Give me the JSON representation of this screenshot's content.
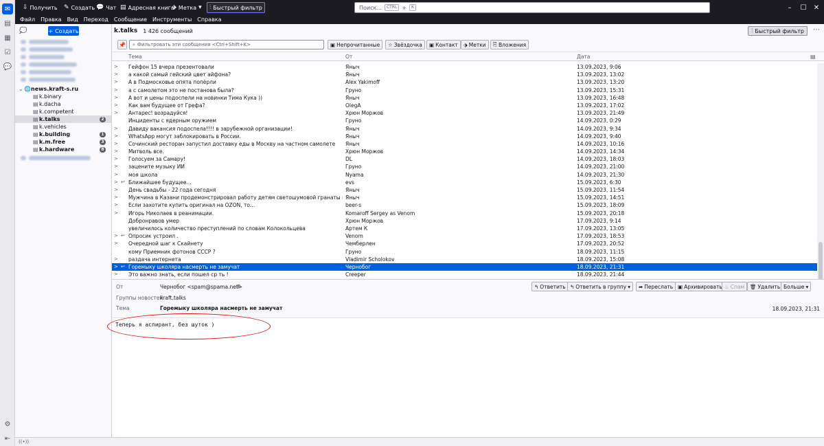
{
  "titlebar": {
    "buttons": [
      "Получить",
      "Создать",
      "Чат",
      "Адресная книга",
      "Метка",
      "Быстрый фильтр"
    ],
    "search_placeholder": "Поиск...",
    "search_kbd1": "CTRL",
    "search_kbd_plus": "+",
    "search_kbd2": "K"
  },
  "menu": [
    "Файл",
    "Правка",
    "Вид",
    "Переход",
    "Сообщение",
    "Инструменты",
    "Справка"
  ],
  "folderpane": {
    "new_button": "Создать",
    "server": "news.kraft-s.ru",
    "folders": [
      {
        "name": "k.binary",
        "bold": false,
        "badge": ""
      },
      {
        "name": "k.dacha",
        "bold": false,
        "badge": ""
      },
      {
        "name": "k.competent",
        "bold": false,
        "badge": ""
      },
      {
        "name": "k.talks",
        "bold": true,
        "badge": "2",
        "selected": true
      },
      {
        "name": "k.vehicles",
        "bold": false,
        "badge": ""
      },
      {
        "name": "k.building",
        "bold": true,
        "badge": "1"
      },
      {
        "name": "k.m.free",
        "bold": true,
        "badge": "3"
      },
      {
        "name": "k.hardware",
        "bold": true,
        "badge": "8"
      }
    ]
  },
  "list": {
    "folder_title": "k.talks",
    "count": "1 426 сообщений",
    "quick_filter": "Быстрый фильтр",
    "filter_placeholder": "Фильтровать эти сообщения <Ctrl+Shift+K>",
    "filters": [
      "Непрочитанные",
      "Звёздочка",
      "Контакт",
      "Метки",
      "Вложения"
    ],
    "columns": {
      "subject": "Тема",
      "from": "От",
      "date": "Дата"
    },
    "rows": [
      {
        "subject": "Гейфон 15 вчера презентовали",
        "from": "Яныч",
        "date": "13.09.2023, 9:06",
        "twisty": true
      },
      {
        "subject": "а какой самый гейский цвет айфона?",
        "from": "Яныч",
        "date": "13.09.2023, 13:02",
        "twisty": true
      },
      {
        "subject": "А в Подмосковье опята попёрли",
        "from": "Alex Yakimoff",
        "date": "13.09.2023, 13:20",
        "twisty": true
      },
      {
        "subject": "а с самолетом это не постанова была?",
        "from": "Груно",
        "date": "13.09.2023, 15:31",
        "twisty": true
      },
      {
        "subject": "А вот и цены подоспели на новинки Тима Кука ))",
        "from": "Яныч",
        "date": "13.09.2023, 16:48",
        "twisty": true
      },
      {
        "subject": "Как вам будущее от Грефа?",
        "from": "OlegA",
        "date": "13.09.2023, 17:02",
        "twisty": true
      },
      {
        "subject": "Антарес! возрадуйся!",
        "from": "Хрюн Моржов",
        "date": "13.09.2023, 21:49",
        "twisty": true
      },
      {
        "subject": "Инциденты с ядерным оружием",
        "from": "Груно",
        "date": "14.09.2023, 0:29",
        "twisty": false
      },
      {
        "subject": "Давиду вакансия подоспела!!!! в зарубежной организации!",
        "from": "Яныч",
        "date": "14.09.2023, 9:34",
        "twisty": true
      },
      {
        "subject": "WhatsApp могут заблокировать в России.",
        "from": "Яныч",
        "date": "14.09.2023, 9:40",
        "twisty": true
      },
      {
        "subject": "Сочинский ресторан запустил доставку еды в Москву на частном самолете",
        "from": "Яныч",
        "date": "14.09.2023, 10:16",
        "twisty": true
      },
      {
        "subject": "Митволь все.",
        "from": "Хрюн Моржов",
        "date": "14.09.2023, 14:34",
        "twisty": true
      },
      {
        "subject": "Голосуем за Самару!",
        "from": "DL",
        "date": "14.09.2023, 18:03",
        "twisty": true
      },
      {
        "subject": "зацените музыку ИИ",
        "from": "Груно",
        "date": "14.09.2023, 21:00",
        "twisty": true
      },
      {
        "subject": "моя школа",
        "from": "Nyama",
        "date": "14.09.2023, 21:30",
        "twisty": true
      },
      {
        "subject": "Ближайшее будущее...",
        "from": "evs",
        "date": "15.09.2023, 6:30",
        "twisty": true,
        "reply": true
      },
      {
        "subject": "День свадьбы - 22 года сегодня",
        "from": "Яныч",
        "date": "15.09.2023, 11:54",
        "twisty": true
      },
      {
        "subject": "Мужчина в Казани продемонстрировал работу детям светошумовой гранаты и взорв...",
        "from": "Яныч",
        "date": "15.09.2023, 14:51",
        "twisty": true
      },
      {
        "subject": "Если захотите купить оригинал на OZON, то...",
        "from": "beer-s",
        "date": "15.09.2023, 18:09",
        "twisty": true,
        "underline": true
      },
      {
        "subject": "Игорь Николаев в реанимации.",
        "from": "Komaroff Sergey as Venom",
        "date": "15.09.2023, 20:18",
        "twisty": true
      },
      {
        "subject": "Добронравов умер",
        "from": "Хрюн Моржов",
        "date": "17.09.2023, 9:14",
        "twisty": false
      },
      {
        "subject": "увеличилось количество преступлений по словам Колокольцева",
        "from": "Артем К",
        "date": "17.09.2023, 13:05",
        "twisty": false
      },
      {
        "subject": "Опросик устроил .",
        "from": "Venom",
        "date": "17.09.2023, 18:53",
        "twisty": true,
        "reply": true
      },
      {
        "subject": "Очередной шаг к Скайнету",
        "from": "Чемберлен",
        "date": "17.09.2023, 20:52",
        "twisty": true
      },
      {
        "subject": "кому Приемник фотонов СССР ?",
        "from": "Груно",
        "date": "18.09.2023, 11:15",
        "twisty": false
      },
      {
        "subject": "раздача интернета",
        "from": "Vladimir Scholokov",
        "date": "18.09.2023, 15:08",
        "twisty": true
      },
      {
        "subject": "Горемыку школяра насмерть не замучат",
        "from": "Чернобог",
        "date": "18.09.2023, 21:31",
        "twisty": true,
        "reply": true,
        "selected": true
      },
      {
        "subject": "Это важно знать, если пошел ср ть !",
        "from": "Creeper",
        "date": "18.09.2023, 21:44",
        "twisty": true,
        "underline": true
      }
    ]
  },
  "message": {
    "from_label": "От",
    "from_value": "Чернобог <spam@spama.net>",
    "newsgroups_label": "Группы новостей",
    "newsgroups_value": "kraft.talks",
    "subject_label": "Тема",
    "subject_value": "Горемыку школяра насмерть не замучат",
    "date": "18.09.2023, 21:31",
    "actions": [
      "Ответить",
      "Ответить в группу",
      "Переслать",
      "Архивировать",
      "Спам",
      "Удалить",
      "Больше"
    ],
    "body": "Теперь я аспирант, без шуток )"
  },
  "status": {
    "text": "((•))"
  },
  "colors": {
    "accent": "#0061e0",
    "titlebar": "#1c1b22",
    "annotation": "#dd1111"
  }
}
